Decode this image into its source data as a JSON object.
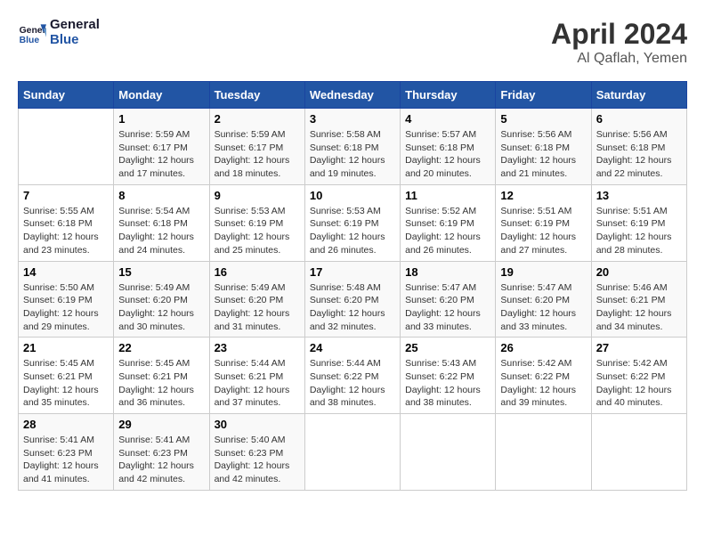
{
  "header": {
    "logo_line1": "General",
    "logo_line2": "Blue",
    "month": "April 2024",
    "location": "Al Qaflah, Yemen"
  },
  "columns": [
    "Sunday",
    "Monday",
    "Tuesday",
    "Wednesday",
    "Thursday",
    "Friday",
    "Saturday"
  ],
  "weeks": [
    [
      {
        "day": "",
        "info": ""
      },
      {
        "day": "1",
        "info": "Sunrise: 5:59 AM\nSunset: 6:17 PM\nDaylight: 12 hours\nand 17 minutes."
      },
      {
        "day": "2",
        "info": "Sunrise: 5:59 AM\nSunset: 6:17 PM\nDaylight: 12 hours\nand 18 minutes."
      },
      {
        "day": "3",
        "info": "Sunrise: 5:58 AM\nSunset: 6:18 PM\nDaylight: 12 hours\nand 19 minutes."
      },
      {
        "day": "4",
        "info": "Sunrise: 5:57 AM\nSunset: 6:18 PM\nDaylight: 12 hours\nand 20 minutes."
      },
      {
        "day": "5",
        "info": "Sunrise: 5:56 AM\nSunset: 6:18 PM\nDaylight: 12 hours\nand 21 minutes."
      },
      {
        "day": "6",
        "info": "Sunrise: 5:56 AM\nSunset: 6:18 PM\nDaylight: 12 hours\nand 22 minutes."
      }
    ],
    [
      {
        "day": "7",
        "info": "Sunrise: 5:55 AM\nSunset: 6:18 PM\nDaylight: 12 hours\nand 23 minutes."
      },
      {
        "day": "8",
        "info": "Sunrise: 5:54 AM\nSunset: 6:18 PM\nDaylight: 12 hours\nand 24 minutes."
      },
      {
        "day": "9",
        "info": "Sunrise: 5:53 AM\nSunset: 6:19 PM\nDaylight: 12 hours\nand 25 minutes."
      },
      {
        "day": "10",
        "info": "Sunrise: 5:53 AM\nSunset: 6:19 PM\nDaylight: 12 hours\nand 26 minutes."
      },
      {
        "day": "11",
        "info": "Sunrise: 5:52 AM\nSunset: 6:19 PM\nDaylight: 12 hours\nand 26 minutes."
      },
      {
        "day": "12",
        "info": "Sunrise: 5:51 AM\nSunset: 6:19 PM\nDaylight: 12 hours\nand 27 minutes."
      },
      {
        "day": "13",
        "info": "Sunrise: 5:51 AM\nSunset: 6:19 PM\nDaylight: 12 hours\nand 28 minutes."
      }
    ],
    [
      {
        "day": "14",
        "info": "Sunrise: 5:50 AM\nSunset: 6:19 PM\nDaylight: 12 hours\nand 29 minutes."
      },
      {
        "day": "15",
        "info": "Sunrise: 5:49 AM\nSunset: 6:20 PM\nDaylight: 12 hours\nand 30 minutes."
      },
      {
        "day": "16",
        "info": "Sunrise: 5:49 AM\nSunset: 6:20 PM\nDaylight: 12 hours\nand 31 minutes."
      },
      {
        "day": "17",
        "info": "Sunrise: 5:48 AM\nSunset: 6:20 PM\nDaylight: 12 hours\nand 32 minutes."
      },
      {
        "day": "18",
        "info": "Sunrise: 5:47 AM\nSunset: 6:20 PM\nDaylight: 12 hours\nand 33 minutes."
      },
      {
        "day": "19",
        "info": "Sunrise: 5:47 AM\nSunset: 6:20 PM\nDaylight: 12 hours\nand 33 minutes."
      },
      {
        "day": "20",
        "info": "Sunrise: 5:46 AM\nSunset: 6:21 PM\nDaylight: 12 hours\nand 34 minutes."
      }
    ],
    [
      {
        "day": "21",
        "info": "Sunrise: 5:45 AM\nSunset: 6:21 PM\nDaylight: 12 hours\nand 35 minutes."
      },
      {
        "day": "22",
        "info": "Sunrise: 5:45 AM\nSunset: 6:21 PM\nDaylight: 12 hours\nand 36 minutes."
      },
      {
        "day": "23",
        "info": "Sunrise: 5:44 AM\nSunset: 6:21 PM\nDaylight: 12 hours\nand 37 minutes."
      },
      {
        "day": "24",
        "info": "Sunrise: 5:44 AM\nSunset: 6:22 PM\nDaylight: 12 hours\nand 38 minutes."
      },
      {
        "day": "25",
        "info": "Sunrise: 5:43 AM\nSunset: 6:22 PM\nDaylight: 12 hours\nand 38 minutes."
      },
      {
        "day": "26",
        "info": "Sunrise: 5:42 AM\nSunset: 6:22 PM\nDaylight: 12 hours\nand 39 minutes."
      },
      {
        "day": "27",
        "info": "Sunrise: 5:42 AM\nSunset: 6:22 PM\nDaylight: 12 hours\nand 40 minutes."
      }
    ],
    [
      {
        "day": "28",
        "info": "Sunrise: 5:41 AM\nSunset: 6:23 PM\nDaylight: 12 hours\nand 41 minutes."
      },
      {
        "day": "29",
        "info": "Sunrise: 5:41 AM\nSunset: 6:23 PM\nDaylight: 12 hours\nand 42 minutes."
      },
      {
        "day": "30",
        "info": "Sunrise: 5:40 AM\nSunset: 6:23 PM\nDaylight: 12 hours\nand 42 minutes."
      },
      {
        "day": "",
        "info": ""
      },
      {
        "day": "",
        "info": ""
      },
      {
        "day": "",
        "info": ""
      },
      {
        "day": "",
        "info": ""
      }
    ]
  ]
}
